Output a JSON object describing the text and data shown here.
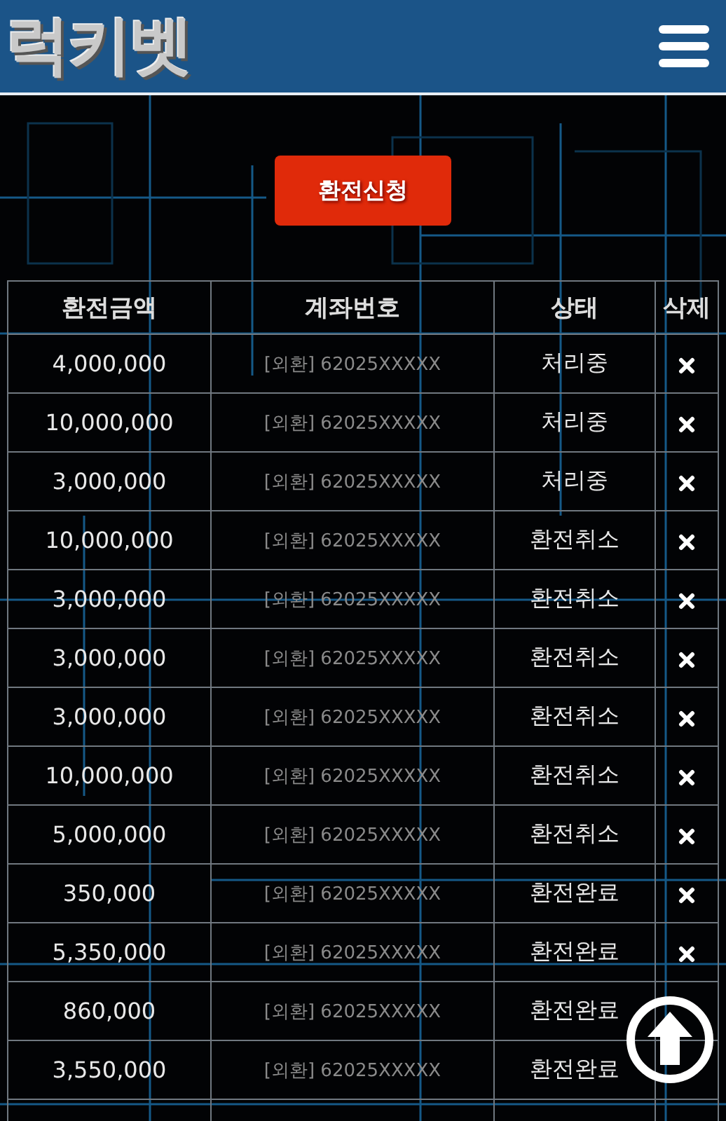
{
  "header": {
    "logo": "럭키벳"
  },
  "action_button": "환전신청",
  "table": {
    "columns": [
      "환전금액",
      "계좌번호",
      "상태",
      "삭제"
    ],
    "rows": [
      {
        "amount": "4,000,000",
        "account": "[외환] 62025XXXXX",
        "status": "처리중"
      },
      {
        "amount": "10,000,000",
        "account": "[외환] 62025XXXXX",
        "status": "처리중"
      },
      {
        "amount": "3,000,000",
        "account": "[외환] 62025XXXXX",
        "status": "처리중"
      },
      {
        "amount": "10,000,000",
        "account": "[외환] 62025XXXXX",
        "status": "환전취소"
      },
      {
        "amount": "3,000,000",
        "account": "[외환] 62025XXXXX",
        "status": "환전취소"
      },
      {
        "amount": "3,000,000",
        "account": "[외환] 62025XXXXX",
        "status": "환전취소"
      },
      {
        "amount": "3,000,000",
        "account": "[외환] 62025XXXXX",
        "status": "환전취소"
      },
      {
        "amount": "10,000,000",
        "account": "[외환] 62025XXXXX",
        "status": "환전취소"
      },
      {
        "amount": "5,000,000",
        "account": "[외환] 62025XXXXX",
        "status": "환전취소"
      },
      {
        "amount": "350,000",
        "account": "[외환] 62025XXXXX",
        "status": "환전완료"
      },
      {
        "amount": "5,350,000",
        "account": "[외환] 62025XXXXX",
        "status": "환전완료"
      },
      {
        "amount": "860,000",
        "account": "[외환] 62025XXXXX",
        "status": "환전완료"
      },
      {
        "amount": "3,550,000",
        "account": "[외환] 62025XXXXX",
        "status": "환전완료"
      }
    ]
  }
}
